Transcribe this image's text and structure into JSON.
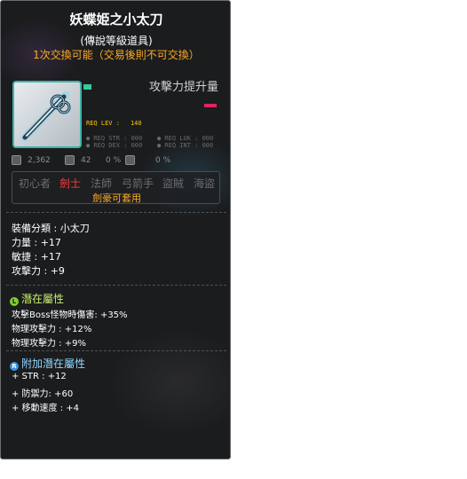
{
  "item": {
    "name": "妖蝶姫之小太刀",
    "rarity": "(傳說等級道具)",
    "trade_note": "1次交換可能（交易後則不可交換）",
    "icon": "sword-icon"
  },
  "attack_increase": {
    "label": "攻擊力提升量"
  },
  "requirements": {
    "lev_label": "REQ LEV :",
    "lev_value": "140",
    "str": "● REQ STR : 000",
    "luk": "● REQ LUK : 000",
    "dex": "● REQ DEX : 000",
    "int": "● REQ INT : 000"
  },
  "stat_row": {
    "first": "2,362",
    "second": "42",
    "third": "0 %",
    "fourth": "0 %"
  },
  "jobs": {
    "list": [
      "初心者",
      "劍士",
      "法師",
      "弓箭手",
      "盜賊",
      "海盜"
    ],
    "active_index": 1,
    "note": "劍豪可套用"
  },
  "base_stats": [
    "裝備分類 : 小太刀",
    "力量 : +17",
    "敏捷 : +17",
    "攻擊力 : +9"
  ],
  "potential": {
    "title": "潛在屬性",
    "lines": [
      "攻擊Boss怪物時傷害: +35%",
      "物理攻擊力 : +12%",
      "物理攻擊力 : +9%"
    ]
  },
  "additional_potential": {
    "title": "附加潛在屬性",
    "lines": [
      "+ STR : +12",
      "+ 防禦力: +60",
      "+ 移動速度 : +4"
    ]
  },
  "colors": {
    "title": "#ffffff",
    "trade": "#ffaa22",
    "active_job": "#ff3b3b",
    "potential": "#c7f06d",
    "additional": "#8ed7ff",
    "frame": "#3fb3a8"
  }
}
